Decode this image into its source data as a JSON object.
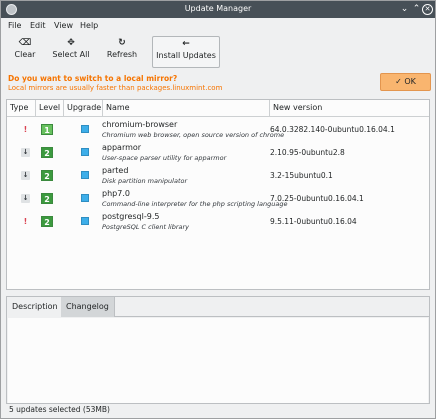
{
  "window": {
    "title": "Update Manager"
  },
  "menu": [
    "File",
    "Edit",
    "View",
    "Help"
  ],
  "toolbar": {
    "clear": "Clear",
    "select_all": "Select All",
    "refresh": "Refresh",
    "install": "Install Updates"
  },
  "mirror": {
    "question": "Do you want to switch to a local mirror?",
    "hint": "Local mirrors are usually faster than packages.linuxmint.com",
    "ok": "OK"
  },
  "table": {
    "headers": {
      "type": "Type",
      "level": "Level",
      "upgrade": "Upgrade",
      "name": "Name",
      "version": "New version"
    },
    "rows": [
      {
        "type": "security",
        "level": "1",
        "name": "chromium-browser",
        "desc": "Chromium web browser, open source version of chrome",
        "version": "64.0.3282.140-0ubuntu0.16.04.1"
      },
      {
        "type": "package",
        "level": "2",
        "name": "apparmor",
        "desc": "User-space parser utility for apparmor",
        "version": "2.10.95-0ubuntu2.8"
      },
      {
        "type": "package",
        "level": "2",
        "name": "parted",
        "desc": "Disk partition manipulator",
        "version": "3.2-15ubuntu0.1"
      },
      {
        "type": "package",
        "level": "2",
        "name": "php7.0",
        "desc": "Command-line interpreter for the php scripting language",
        "version": "7.0.25-0ubuntu0.16.04.1"
      },
      {
        "type": "security",
        "level": "2",
        "name": "postgresql-9.5",
        "desc": "PostgreSQL C client library",
        "version": "9.5.11-0ubuntu0.16.04"
      }
    ]
  },
  "tabs": {
    "description": "Description",
    "changelog": "Changelog"
  },
  "status": "5 updates selected (53MB)",
  "colors": {
    "accent": "#3daee9",
    "warning": "#f67400",
    "titlebar": "#475057",
    "security": "#da4453"
  }
}
